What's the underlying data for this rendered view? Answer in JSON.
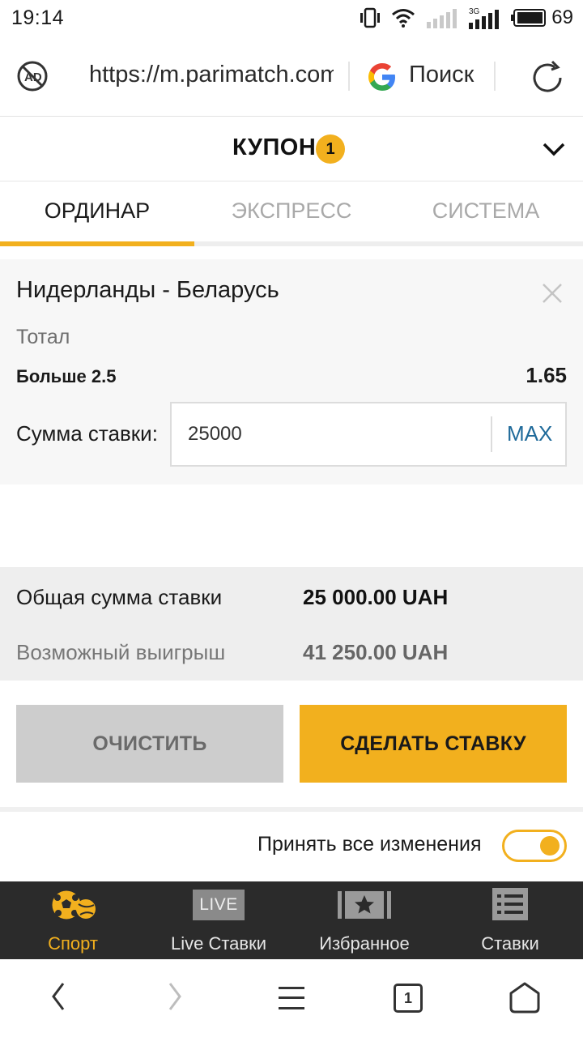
{
  "status_bar": {
    "time": "19:14",
    "battery": "69",
    "network": "3G",
    "icons": [
      "vibrate-icon",
      "wifi-icon",
      "signal-icon",
      "signal-3g-icon",
      "battery-icon"
    ]
  },
  "browser": {
    "url": "https://m.parimatch.com",
    "search_label": "Поиск",
    "icons": [
      "ad-block-icon",
      "google-icon",
      "reload-icon"
    ]
  },
  "coupon": {
    "title": "КУПОН",
    "count": "1"
  },
  "tabs": [
    {
      "label": "ОРДИНАР",
      "active": true
    },
    {
      "label": "ЭКСПРЕСС",
      "active": false
    },
    {
      "label": "СИСТЕМА",
      "active": false
    }
  ],
  "bet": {
    "event": "Нидерланды - Беларусь",
    "market": "Тотал",
    "outcome": "Больше 2.5",
    "odds": "1.65",
    "stake_label": "Сумма ставки:",
    "stake_value": "25000",
    "max_label": "MAX"
  },
  "summary": {
    "total_label": "Общая сумма ставки",
    "total_value": "25 000.00 UAH",
    "win_label": "Возможный выигрыш",
    "win_value": "41 250.00 UAH"
  },
  "actions": {
    "clear_label": "ОЧИСТИТЬ",
    "place_label": "СДЕЛАТЬ СТАВКУ"
  },
  "accept_changes": {
    "label": "Принять все изменения",
    "enabled": true
  },
  "bottom_nav": [
    {
      "label": "Спорт",
      "icon": "sport-icon",
      "active": true
    },
    {
      "label": "Live Ставки",
      "icon": "live-icon",
      "badge": "LIVE",
      "active": false
    },
    {
      "label": "Избранное",
      "icon": "favorites-icon",
      "active": false
    },
    {
      "label": "Ставки",
      "icon": "bets-list-icon",
      "active": false
    }
  ],
  "android_nav": {
    "tabs_count": "1"
  },
  "colors": {
    "accent": "#f2b01e",
    "nav_bg": "#2b2b2b",
    "link": "#1f6a9a"
  }
}
